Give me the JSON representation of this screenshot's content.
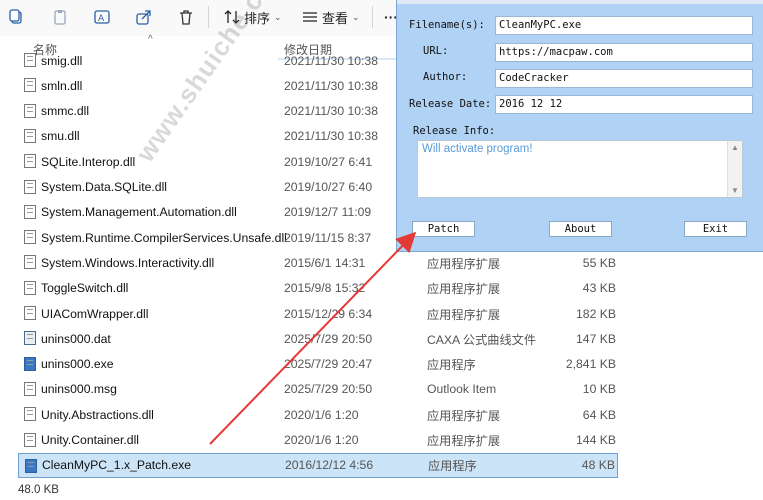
{
  "toolbar": {
    "sort_label": "排序",
    "view_label": "查看",
    "more_label": "···"
  },
  "columns": {
    "name": "名称",
    "date": "修改日期"
  },
  "files": [
    {
      "name": "smig.dll",
      "date": "2021/11/30 10:38",
      "type": "",
      "size": "",
      "icon": "dll"
    },
    {
      "name": "smln.dll",
      "date": "2021/11/30 10:38",
      "type": "",
      "size": "",
      "icon": "dll"
    },
    {
      "name": "smmc.dll",
      "date": "2021/11/30 10:38",
      "type": "",
      "size": "",
      "icon": "dll"
    },
    {
      "name": "smu.dll",
      "date": "2021/11/30 10:38",
      "type": "",
      "size": "",
      "icon": "dll"
    },
    {
      "name": "SQLite.Interop.dll",
      "date": "2019/10/27 6:41",
      "type": "",
      "size": "",
      "icon": "dll"
    },
    {
      "name": "System.Data.SQLite.dll",
      "date": "2019/10/27 6:40",
      "type": "",
      "size": "",
      "icon": "dll"
    },
    {
      "name": "System.Management.Automation.dll",
      "date": "2019/12/7 11:09",
      "type": "",
      "size": "",
      "icon": "dll"
    },
    {
      "name": "System.Runtime.CompilerServices.Unsafe.dll",
      "date": "2019/11/15 8:37",
      "type": "",
      "size": "",
      "icon": "dll"
    },
    {
      "name": "System.Windows.Interactivity.dll",
      "date": "2015/6/1 14:31",
      "type": "应用程序扩展",
      "size": "55 KB",
      "icon": "dll"
    },
    {
      "name": "ToggleSwitch.dll",
      "date": "2015/9/8 15:32",
      "type": "应用程序扩展",
      "size": "43 KB",
      "icon": "dll"
    },
    {
      "name": "UIAComWrapper.dll",
      "date": "2015/12/29 6:34",
      "type": "应用程序扩展",
      "size": "182 KB",
      "icon": "dll"
    },
    {
      "name": "unins000.dat",
      "date": "2025/7/29 20:50",
      "type": "CAXA 公式曲线文件",
      "size": "147 KB",
      "icon": "dat"
    },
    {
      "name": "unins000.exe",
      "date": "2025/7/29 20:47",
      "type": "应用程序",
      "size": "2,841 KB",
      "icon": "exe"
    },
    {
      "name": "unins000.msg",
      "date": "2025/7/29 20:50",
      "type": "Outlook Item",
      "size": "10 KB",
      "icon": "msg"
    },
    {
      "name": "Unity.Abstractions.dll",
      "date": "2020/1/6 1:20",
      "type": "应用程序扩展",
      "size": "64 KB",
      "icon": "dll"
    },
    {
      "name": "Unity.Container.dll",
      "date": "2020/1/6 1:20",
      "type": "应用程序扩展",
      "size": "144 KB",
      "icon": "dll"
    },
    {
      "name": "CleanMyPC_1.x_Patch.exe",
      "date": "2016/12/12 4:56",
      "type": "应用程序",
      "size": "48 KB",
      "icon": "exe",
      "selected": true
    }
  ],
  "status": {
    "selected_size": "48.0 KB"
  },
  "watermark": "www.shuiche.cc",
  "dialog": {
    "filenames_label": "Filename(s):",
    "filenames_value": "CleanMyPC.exe",
    "url_label": "URL:",
    "url_value": "https://macpaw.com",
    "author_label": "Author:",
    "author_value": "CodeCracker",
    "release_date_label": "Release Date:",
    "release_date_value": "2016 12 12",
    "release_info_label": "Release Info:",
    "release_info_value": "Will activate program!",
    "patch_label": "Patch",
    "about_label": "About",
    "exit_label": "Exit"
  },
  "colors": {
    "dialog_bg": "#b0d2f4",
    "selection_bg": "#cce4f7",
    "arrow": "#e53935",
    "info_text": "#5a9bd6"
  }
}
